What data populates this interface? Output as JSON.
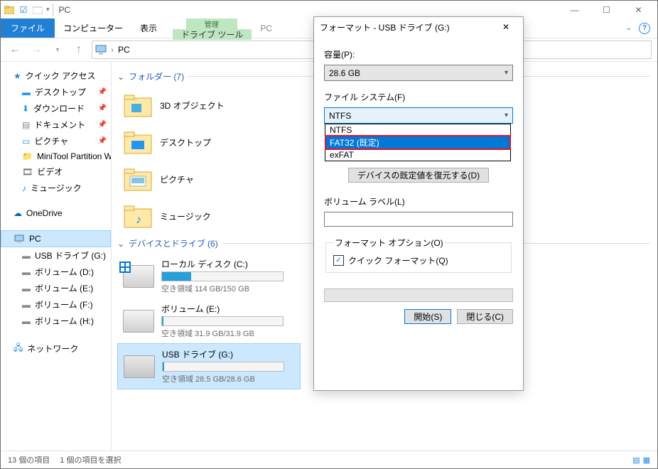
{
  "qat": {
    "title": "PC"
  },
  "ribbon": {
    "file": "ファイル",
    "tabs": [
      "コンピューター",
      "表示"
    ],
    "ctx_group": "管理",
    "ctx_tab": "ドライブ ツール",
    "title": "PC"
  },
  "address": {
    "path": "PC"
  },
  "nav": {
    "quick": "クイック アクセス",
    "items": [
      "デスクトップ",
      "ダウンロード",
      "ドキュメント",
      "ピクチャ"
    ],
    "more": [
      "MiniTool Partition W…",
      "ビデオ",
      "ミュージック"
    ],
    "onedrive": "OneDrive",
    "pc": "PC",
    "drives": [
      "USB ドライブ (G:)",
      "ボリューム (D:)",
      "ボリューム (E:)",
      "ボリューム (F:)",
      "ボリューム (H:)"
    ],
    "network": "ネットワーク"
  },
  "groups": {
    "folders_hdr": "フォルダー (7)",
    "folders": [
      "3D オブジェクト",
      "デスクトップ",
      "ピクチャ",
      "ミュージック"
    ],
    "drives_hdr": "デバイスとドライブ (6)",
    "drives": [
      {
        "name": "ローカル ディスク (C:)",
        "free": "空き領域 114 GB/150 GB",
        "pct": 24
      },
      {
        "name": "ボリューム (E:)",
        "free": "空き領域 31.9 GB/31.9 GB",
        "pct": 1
      },
      {
        "name": "USB ドライブ (G:)",
        "free": "空き領域 28.5 GB/28.6 GB",
        "pct": 1
      }
    ]
  },
  "status": {
    "count": "13 個の項目",
    "sel": "1 個の項目を選択"
  },
  "dialog": {
    "title": "フォーマット - USB ドライブ (G:)",
    "capacity_lbl": "容量(P):",
    "capacity": "28.6 GB",
    "fs_lbl": "ファイル システム(F)",
    "fs_sel": "NTFS",
    "fs_opts": [
      "NTFS",
      "FAT32 (既定)",
      "exFAT"
    ],
    "alloc_btn": "デバイスの既定値を復元する(D)",
    "vol_lbl": "ボリューム ラベル(L)",
    "vol_val": "",
    "opt_hdr": "フォーマット オプション(O)",
    "quick": "クイック フォーマット(Q)",
    "start": "開始(S)",
    "close": "閉じる(C)"
  }
}
